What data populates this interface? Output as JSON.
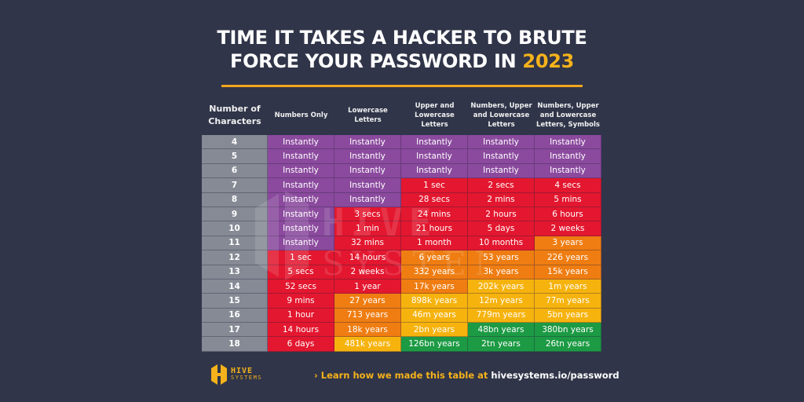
{
  "title": {
    "line1": "TIME IT TAKES A HACKER TO BRUTE",
    "line2_prefix": "FORCE YOUR PASSWORD IN ",
    "year": "2023"
  },
  "colors": {
    "background": "#303549",
    "accent": "#f5b21b",
    "instantly": "#8b4a9e",
    "red": "#e3172f",
    "orange": "#ef7d12",
    "yellow": "#f6b30e",
    "green": "#1c9a44",
    "count_col": "#858a94"
  },
  "table": {
    "headers": [
      "Number of Characters",
      "Numbers Only",
      "Lowercase Letters",
      "Upper and Lowercase Letters",
      "Numbers, Upper and Lowercase Letters",
      "Numbers, Upper and Lowercase Letters, Symbols"
    ],
    "rows": [
      {
        "chars": "4",
        "cells": [
          [
            "Instantly",
            "p"
          ],
          [
            "Instantly",
            "p"
          ],
          [
            "Instantly",
            "p"
          ],
          [
            "Instantly",
            "p"
          ],
          [
            "Instantly",
            "p"
          ]
        ]
      },
      {
        "chars": "5",
        "cells": [
          [
            "Instantly",
            "p"
          ],
          [
            "Instantly",
            "p"
          ],
          [
            "Instantly",
            "p"
          ],
          [
            "Instantly",
            "p"
          ],
          [
            "Instantly",
            "p"
          ]
        ]
      },
      {
        "chars": "6",
        "cells": [
          [
            "Instantly",
            "p"
          ],
          [
            "Instantly",
            "p"
          ],
          [
            "Instantly",
            "p"
          ],
          [
            "Instantly",
            "p"
          ],
          [
            "Instantly",
            "p"
          ]
        ]
      },
      {
        "chars": "7",
        "cells": [
          [
            "Instantly",
            "p"
          ],
          [
            "Instantly",
            "p"
          ],
          [
            "1 sec",
            "r"
          ],
          [
            "2 secs",
            "r"
          ],
          [
            "4 secs",
            "r"
          ]
        ]
      },
      {
        "chars": "8",
        "cells": [
          [
            "Instantly",
            "p"
          ],
          [
            "Instantly",
            "p"
          ],
          [
            "28 secs",
            "r"
          ],
          [
            "2 mins",
            "r"
          ],
          [
            "5 mins",
            "r"
          ]
        ]
      },
      {
        "chars": "9",
        "cells": [
          [
            "Instantly",
            "p"
          ],
          [
            "3 secs",
            "r"
          ],
          [
            "24 mins",
            "r"
          ],
          [
            "2 hours",
            "r"
          ],
          [
            "6 hours",
            "r"
          ]
        ]
      },
      {
        "chars": "10",
        "cells": [
          [
            "Instantly",
            "p"
          ],
          [
            "1 min",
            "r"
          ],
          [
            "21 hours",
            "r"
          ],
          [
            "5 days",
            "r"
          ],
          [
            "2 weeks",
            "r"
          ]
        ]
      },
      {
        "chars": "11",
        "cells": [
          [
            "Instantly",
            "p"
          ],
          [
            "32 mins",
            "r"
          ],
          [
            "1 month",
            "r"
          ],
          [
            "10 months",
            "r"
          ],
          [
            "3 years",
            "o"
          ]
        ]
      },
      {
        "chars": "12",
        "cells": [
          [
            "1 sec",
            "r"
          ],
          [
            "14 hours",
            "r"
          ],
          [
            "6 years",
            "o"
          ],
          [
            "53 years",
            "o"
          ],
          [
            "226 years",
            "o"
          ]
        ]
      },
      {
        "chars": "13",
        "cells": [
          [
            "5 secs",
            "r"
          ],
          [
            "2 weeks",
            "r"
          ],
          [
            "332 years",
            "o"
          ],
          [
            "3k years",
            "o"
          ],
          [
            "15k years",
            "o"
          ]
        ]
      },
      {
        "chars": "14",
        "cells": [
          [
            "52 secs",
            "r"
          ],
          [
            "1 year",
            "r"
          ],
          [
            "17k years",
            "o"
          ],
          [
            "202k years",
            "y"
          ],
          [
            "1m years",
            "y"
          ]
        ]
      },
      {
        "chars": "15",
        "cells": [
          [
            "9 mins",
            "r"
          ],
          [
            "27 years",
            "o"
          ],
          [
            "898k years",
            "y"
          ],
          [
            "12m years",
            "y"
          ],
          [
            "77m years",
            "y"
          ]
        ]
      },
      {
        "chars": "16",
        "cells": [
          [
            "1 hour",
            "r"
          ],
          [
            "713 years",
            "o"
          ],
          [
            "46m years",
            "y"
          ],
          [
            "779m years",
            "y"
          ],
          [
            "5bn years",
            "y"
          ]
        ]
      },
      {
        "chars": "17",
        "cells": [
          [
            "14 hours",
            "r"
          ],
          [
            "18k years",
            "o"
          ],
          [
            "2bn years",
            "y"
          ],
          [
            "48bn years",
            "g"
          ],
          [
            "380bn years",
            "g"
          ]
        ]
      },
      {
        "chars": "18",
        "cells": [
          [
            "6 days",
            "r"
          ],
          [
            "481k years",
            "y"
          ],
          [
            "126bn years",
            "g"
          ],
          [
            "2tn years",
            "g"
          ],
          [
            "26tn years",
            "g"
          ]
        ]
      }
    ]
  },
  "footer": {
    "logo_line1": "HIVE",
    "logo_line2": "SYSTEMS",
    "link_lead": "› Learn how we made this table at ",
    "link_url": "hivesystems.io/password"
  },
  "watermark": {
    "line1": "HIVE",
    "line2": "SYSTEMS"
  }
}
